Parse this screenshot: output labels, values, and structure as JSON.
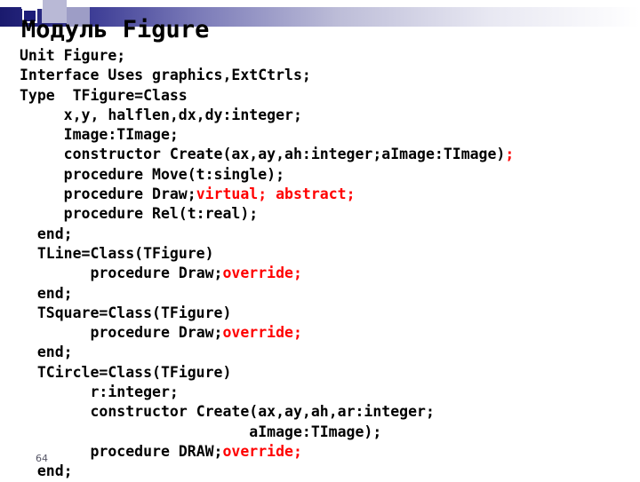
{
  "slide": {
    "title": "Модуль Figure",
    "page_number": "64",
    "accent_colors": {
      "band_dark": "#1a1a6e",
      "band_mid": "#8a8ac4",
      "band_light": "#ffffff",
      "keyword_red": "#ff0000",
      "text_black": "#000000"
    }
  },
  "code": {
    "lines": [
      {
        "indent": 0,
        "segments": [
          {
            "text": "Unit Figure;",
            "color": "black"
          }
        ]
      },
      {
        "indent": 0,
        "segments": [
          {
            "text": "Interface Uses graphics,ExtCtrls;",
            "color": "black"
          }
        ]
      },
      {
        "indent": 0,
        "segments": [
          {
            "text": "Type  TFigure=Class",
            "color": "black"
          }
        ]
      },
      {
        "indent": 5,
        "segments": [
          {
            "text": "x,y, halflen,dx,dy:integer;",
            "color": "black"
          }
        ]
      },
      {
        "indent": 5,
        "segments": [
          {
            "text": "Image:TImage;",
            "color": "black"
          }
        ]
      },
      {
        "indent": 5,
        "segments": [
          {
            "text": "constructor Create(ax,ay,ah:integer;aImage:TImage)",
            "color": "black"
          },
          {
            "text": ";",
            "color": "red"
          }
        ]
      },
      {
        "indent": 5,
        "segments": [
          {
            "text": "procedure Move(t:single);",
            "color": "black"
          }
        ]
      },
      {
        "indent": 5,
        "segments": [
          {
            "text": "procedure Draw;",
            "color": "black"
          },
          {
            "text": "virtual; abstract;",
            "color": "red"
          }
        ]
      },
      {
        "indent": 5,
        "segments": [
          {
            "text": "procedure Rel(t:real);",
            "color": "black"
          }
        ]
      },
      {
        "indent": 2,
        "segments": [
          {
            "text": "end;",
            "color": "black"
          }
        ]
      },
      {
        "indent": 2,
        "segments": [
          {
            "text": "TLine=Class(TFigure)",
            "color": "black"
          }
        ]
      },
      {
        "indent": 8,
        "segments": [
          {
            "text": "procedure Draw;",
            "color": "black"
          },
          {
            "text": "override;",
            "color": "red"
          }
        ]
      },
      {
        "indent": 2,
        "segments": [
          {
            "text": "end;",
            "color": "black"
          }
        ]
      },
      {
        "indent": 2,
        "segments": [
          {
            "text": "TSquare=Class(TFigure)",
            "color": "black"
          }
        ]
      },
      {
        "indent": 8,
        "segments": [
          {
            "text": "procedure Draw;",
            "color": "black"
          },
          {
            "text": "override;",
            "color": "red"
          }
        ]
      },
      {
        "indent": 2,
        "segments": [
          {
            "text": "end;",
            "color": "black"
          }
        ]
      },
      {
        "indent": 2,
        "segments": [
          {
            "text": "TCircle=Class(TFigure)",
            "color": "black"
          }
        ]
      },
      {
        "indent": 8,
        "segments": [
          {
            "text": "r:integer;",
            "color": "black"
          }
        ]
      },
      {
        "indent": 8,
        "segments": [
          {
            "text": "constructor Create(ax,ay,ah,ar:integer;",
            "color": "black"
          }
        ]
      },
      {
        "indent": 26,
        "segments": [
          {
            "text": "aImage:TImage);",
            "color": "black"
          }
        ]
      },
      {
        "indent": 8,
        "segments": [
          {
            "text": "procedure DRAW;",
            "color": "black"
          },
          {
            "text": "override;",
            "color": "red"
          }
        ]
      },
      {
        "indent": 2,
        "segments": [
          {
            "text": "end;",
            "color": "black"
          }
        ]
      }
    ]
  }
}
